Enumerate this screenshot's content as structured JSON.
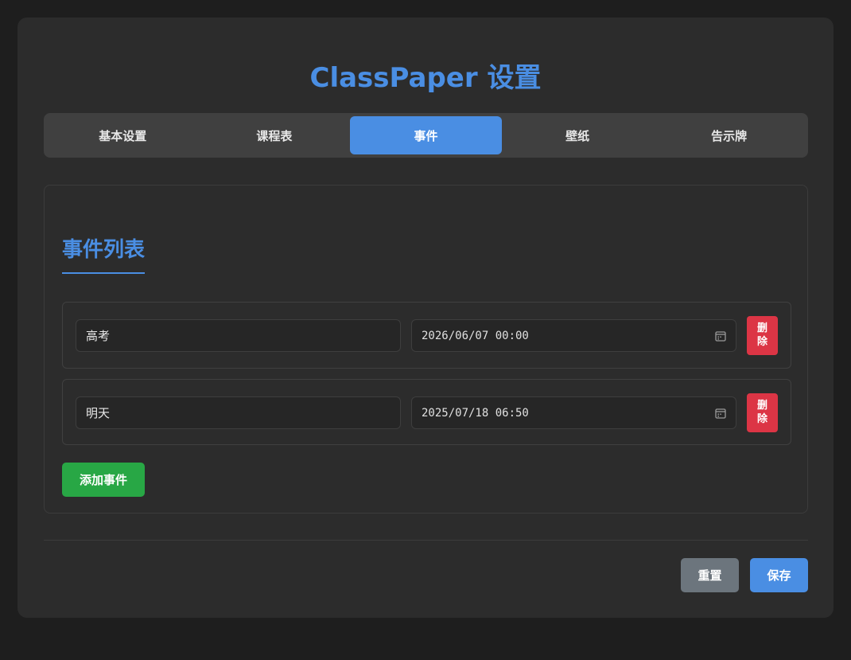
{
  "app": {
    "title": "ClassPaper 设置"
  },
  "tabs": [
    {
      "label": "基本设置",
      "active": false
    },
    {
      "label": "课程表",
      "active": false
    },
    {
      "label": "事件",
      "active": true
    },
    {
      "label": "壁纸",
      "active": false
    },
    {
      "label": "告示牌",
      "active": false
    }
  ],
  "events_section": {
    "title": "事件列表",
    "events": [
      {
        "name": "高考",
        "datetime": "2026/06/07  00:00",
        "delete_label": "删除"
      },
      {
        "name": "明天",
        "datetime": "2025/07/18  06:50",
        "delete_label": "删除"
      }
    ],
    "add_label": "添加事件"
  },
  "footer": {
    "reset_label": "重置",
    "save_label": "保存"
  },
  "colors": {
    "accent": "#4a8ee3",
    "danger": "#dc3545",
    "success": "#28a745",
    "secondary": "#6c757d",
    "background": "#1e1e1e",
    "card": "#2c2c2c"
  },
  "icons": {
    "date_picker": "calendar-icon"
  }
}
